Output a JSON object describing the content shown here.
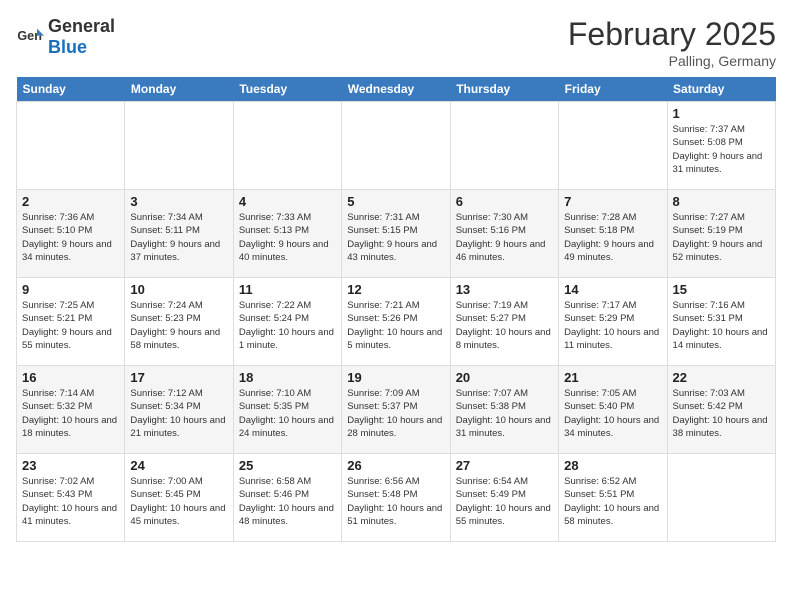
{
  "logo": {
    "general": "General",
    "blue": "Blue"
  },
  "title": "February 2025",
  "location": "Palling, Germany",
  "days_of_week": [
    "Sunday",
    "Monday",
    "Tuesday",
    "Wednesday",
    "Thursday",
    "Friday",
    "Saturday"
  ],
  "weeks": [
    [
      {
        "day": "",
        "info": ""
      },
      {
        "day": "",
        "info": ""
      },
      {
        "day": "",
        "info": ""
      },
      {
        "day": "",
        "info": ""
      },
      {
        "day": "",
        "info": ""
      },
      {
        "day": "",
        "info": ""
      },
      {
        "day": "1",
        "info": "Sunrise: 7:37 AM\nSunset: 5:08 PM\nDaylight: 9 hours and 31 minutes."
      }
    ],
    [
      {
        "day": "2",
        "info": "Sunrise: 7:36 AM\nSunset: 5:10 PM\nDaylight: 9 hours and 34 minutes."
      },
      {
        "day": "3",
        "info": "Sunrise: 7:34 AM\nSunset: 5:11 PM\nDaylight: 9 hours and 37 minutes."
      },
      {
        "day": "4",
        "info": "Sunrise: 7:33 AM\nSunset: 5:13 PM\nDaylight: 9 hours and 40 minutes."
      },
      {
        "day": "5",
        "info": "Sunrise: 7:31 AM\nSunset: 5:15 PM\nDaylight: 9 hours and 43 minutes."
      },
      {
        "day": "6",
        "info": "Sunrise: 7:30 AM\nSunset: 5:16 PM\nDaylight: 9 hours and 46 minutes."
      },
      {
        "day": "7",
        "info": "Sunrise: 7:28 AM\nSunset: 5:18 PM\nDaylight: 9 hours and 49 minutes."
      },
      {
        "day": "8",
        "info": "Sunrise: 7:27 AM\nSunset: 5:19 PM\nDaylight: 9 hours and 52 minutes."
      }
    ],
    [
      {
        "day": "9",
        "info": "Sunrise: 7:25 AM\nSunset: 5:21 PM\nDaylight: 9 hours and 55 minutes."
      },
      {
        "day": "10",
        "info": "Sunrise: 7:24 AM\nSunset: 5:23 PM\nDaylight: 9 hours and 58 minutes."
      },
      {
        "day": "11",
        "info": "Sunrise: 7:22 AM\nSunset: 5:24 PM\nDaylight: 10 hours and 1 minute."
      },
      {
        "day": "12",
        "info": "Sunrise: 7:21 AM\nSunset: 5:26 PM\nDaylight: 10 hours and 5 minutes."
      },
      {
        "day": "13",
        "info": "Sunrise: 7:19 AM\nSunset: 5:27 PM\nDaylight: 10 hours and 8 minutes."
      },
      {
        "day": "14",
        "info": "Sunrise: 7:17 AM\nSunset: 5:29 PM\nDaylight: 10 hours and 11 minutes."
      },
      {
        "day": "15",
        "info": "Sunrise: 7:16 AM\nSunset: 5:31 PM\nDaylight: 10 hours and 14 minutes."
      }
    ],
    [
      {
        "day": "16",
        "info": "Sunrise: 7:14 AM\nSunset: 5:32 PM\nDaylight: 10 hours and 18 minutes."
      },
      {
        "day": "17",
        "info": "Sunrise: 7:12 AM\nSunset: 5:34 PM\nDaylight: 10 hours and 21 minutes."
      },
      {
        "day": "18",
        "info": "Sunrise: 7:10 AM\nSunset: 5:35 PM\nDaylight: 10 hours and 24 minutes."
      },
      {
        "day": "19",
        "info": "Sunrise: 7:09 AM\nSunset: 5:37 PM\nDaylight: 10 hours and 28 minutes."
      },
      {
        "day": "20",
        "info": "Sunrise: 7:07 AM\nSunset: 5:38 PM\nDaylight: 10 hours and 31 minutes."
      },
      {
        "day": "21",
        "info": "Sunrise: 7:05 AM\nSunset: 5:40 PM\nDaylight: 10 hours and 34 minutes."
      },
      {
        "day": "22",
        "info": "Sunrise: 7:03 AM\nSunset: 5:42 PM\nDaylight: 10 hours and 38 minutes."
      }
    ],
    [
      {
        "day": "23",
        "info": "Sunrise: 7:02 AM\nSunset: 5:43 PM\nDaylight: 10 hours and 41 minutes."
      },
      {
        "day": "24",
        "info": "Sunrise: 7:00 AM\nSunset: 5:45 PM\nDaylight: 10 hours and 45 minutes."
      },
      {
        "day": "25",
        "info": "Sunrise: 6:58 AM\nSunset: 5:46 PM\nDaylight: 10 hours and 48 minutes."
      },
      {
        "day": "26",
        "info": "Sunrise: 6:56 AM\nSunset: 5:48 PM\nDaylight: 10 hours and 51 minutes."
      },
      {
        "day": "27",
        "info": "Sunrise: 6:54 AM\nSunset: 5:49 PM\nDaylight: 10 hours and 55 minutes."
      },
      {
        "day": "28",
        "info": "Sunrise: 6:52 AM\nSunset: 5:51 PM\nDaylight: 10 hours and 58 minutes."
      },
      {
        "day": "",
        "info": ""
      }
    ]
  ]
}
